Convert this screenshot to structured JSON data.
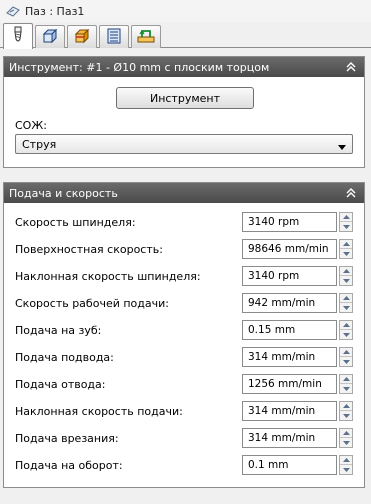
{
  "window": {
    "title": "Паз : Паз1"
  },
  "tabs": [
    {
      "icon": "tool-icon",
      "active": true
    },
    {
      "icon": "geometry-icon",
      "active": false
    },
    {
      "icon": "heights-icon",
      "active": false
    },
    {
      "icon": "passes-icon",
      "active": false
    },
    {
      "icon": "linking-icon",
      "active": false
    }
  ],
  "tool_section": {
    "header": "Инструмент: #1 - Ø10 mm с плоским торцом",
    "tool_button": "Инструмент",
    "coolant_label": "СОЖ:",
    "coolant_value": "Струя"
  },
  "feed_section": {
    "header": "Подача и скорость",
    "rows": [
      {
        "label": "Скорость шпинделя:",
        "value": "3140 rpm"
      },
      {
        "label": "Поверхностная скорость:",
        "value": "98646 mm/min"
      },
      {
        "label": "Наклонная скорость шпинделя:",
        "value": "3140 rpm"
      },
      {
        "label": "Скорость рабочей подачи:",
        "value": "942 mm/min"
      },
      {
        "label": "Подача на зуб:",
        "value": "0.15 mm"
      },
      {
        "label": "Подача подвода:",
        "value": "314 mm/min"
      },
      {
        "label": "Подача отвода:",
        "value": "1256 mm/min"
      },
      {
        "label": "Наклонная скорость подачи:",
        "value": "314 mm/min"
      },
      {
        "label": "Подача врезания:",
        "value": "314 mm/min"
      },
      {
        "label": "Подача на оборот:",
        "value": "0.1 mm"
      }
    ]
  },
  "colors": {
    "header_bg": "#5a5a5a",
    "header_text": "#ffffff",
    "accent": "#e8a000"
  }
}
